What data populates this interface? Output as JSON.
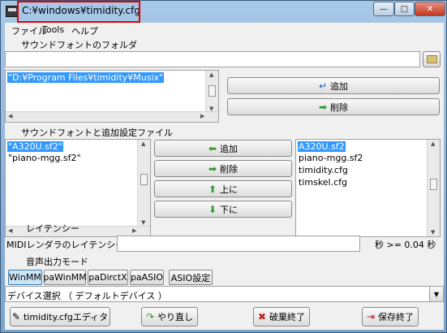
{
  "window": {
    "title": "C:¥windows¥timidity.cfg",
    "controls": {
      "minimize": "—",
      "maximize": "□",
      "close": "✕"
    }
  },
  "menu": {
    "file": "ファイル",
    "tools": "Tools",
    "help": "ヘルプ"
  },
  "soundfont_folder": {
    "label": "サウンドフォントのフォルダ",
    "path_value": "",
    "list": [
      "\"D:¥Program Files¥timidity¥Musix\""
    ],
    "add_label": "追加",
    "delete_label": "削除"
  },
  "soundfont_files": {
    "label": "サウンドフォントと追加設定ファイル",
    "selected_list": [
      "\"A320U.sf2\"",
      "\"piano-mgg.sf2\""
    ],
    "available_list": [
      "A320U.sf2",
      "piano-mgg.sf2",
      "timidity.cfg",
      "timskel.cfg"
    ],
    "add_label": "追加",
    "delete_label": "削除",
    "up_label": "上に",
    "down_label": "下に"
  },
  "latency": {
    "section_label": "レイテンシー",
    "midi_label": "MIDIレンダラのレイテンシー",
    "value_text": "秒 >= 0.04 秒"
  },
  "audio_mode": {
    "section_label": "音声出力モード",
    "modes": [
      "WinMM",
      "paWinMM",
      "paDirctX",
      "paASIO"
    ],
    "asio_settings": "ASIO設定"
  },
  "device": {
    "selected": "デバイス選択 （ デフォルトデバイス ）"
  },
  "footer": {
    "editor": "timidity.cfgエディタ",
    "redo": "やり直し",
    "discard": "破棄終了",
    "save": "保存終了"
  },
  "colors": {
    "selection": "#3399ff",
    "highlight_box": "#e00000"
  }
}
